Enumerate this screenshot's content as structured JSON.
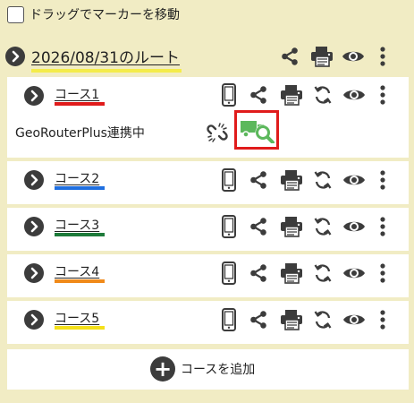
{
  "drag_toggle": {
    "label": "ドラッグでマーカーを移動",
    "checked": false
  },
  "route": {
    "title": "2026/08/31のルート",
    "underline_color": "#f4ec4a"
  },
  "courses": [
    {
      "name": "コース1",
      "color": "#e01b1b"
    },
    {
      "name": "コース2",
      "color": "#1f6fe0"
    },
    {
      "name": "コース3",
      "color": "#1e7b3a"
    },
    {
      "name": "コース4",
      "color": "#f08a1a"
    },
    {
      "name": "コース5",
      "color": "#f4e01a"
    }
  ],
  "geo_router": {
    "label": "GeoRouterPlus連携中"
  },
  "add_course": {
    "label": "コースを追加"
  },
  "icons": {
    "expand": "chevron-right-icon",
    "share": "share-icon",
    "print": "printer-icon",
    "view": "eye-icon",
    "menu": "kebab-menu-icon",
    "mobile": "smartphone-icon",
    "sync": "sync-icon",
    "link": "broken-link-icon",
    "truck_search": "truck-search-icon",
    "add": "plus-circle-icon"
  },
  "colors": {
    "background": "#f1ecc4",
    "card": "#ffffff",
    "icon": "#3c3c3c",
    "highlight": "#e01b1b",
    "truck": "#5cb85c"
  }
}
